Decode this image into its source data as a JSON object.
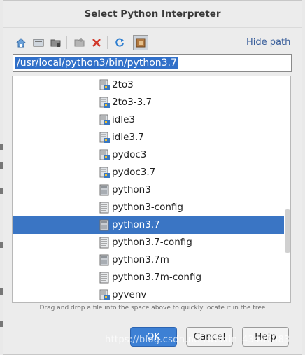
{
  "dialog": {
    "title": "Select Python Interpreter",
    "hide_path_label": "Hide path",
    "path_value": "/usr/local/python3/bin/python3.7",
    "hint": "Drag and drop a file into the space above to quickly locate it in the tree"
  },
  "toolbar": {
    "buttons": [
      "home-icon",
      "desktop-icon",
      "project-folder-icon",
      "new-folder-icon",
      "delete-icon",
      "refresh-icon",
      "show-hidden-icon"
    ]
  },
  "tree": {
    "items": [
      {
        "label": "2to3",
        "kind": "script"
      },
      {
        "label": "2to3-3.7",
        "kind": "script"
      },
      {
        "label": "idle3",
        "kind": "script"
      },
      {
        "label": "idle3.7",
        "kind": "script"
      },
      {
        "label": "pydoc3",
        "kind": "script"
      },
      {
        "label": "pydoc3.7",
        "kind": "script"
      },
      {
        "label": "python3",
        "kind": "executable"
      },
      {
        "label": "python3-config",
        "kind": "text"
      },
      {
        "label": "python3.7",
        "kind": "executable",
        "selected": true
      },
      {
        "label": "python3.7-config",
        "kind": "text"
      },
      {
        "label": "python3.7m",
        "kind": "executable"
      },
      {
        "label": "python3.7m-config",
        "kind": "text"
      },
      {
        "label": "pyvenv",
        "kind": "script"
      }
    ]
  },
  "buttons": {
    "ok": "OK",
    "cancel": "Cancel",
    "help": "Help"
  },
  "watermark": "https://blog.csdn.net/weixin_43467083"
}
